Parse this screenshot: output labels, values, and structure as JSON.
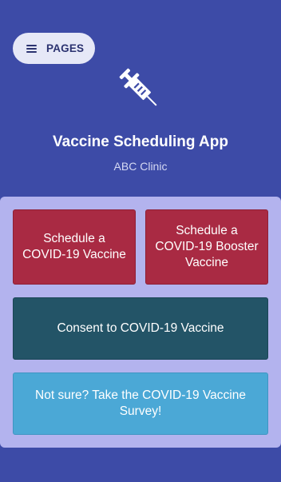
{
  "header": {
    "pages_label": "PAGES",
    "menu_icon": "hamburger-menu-icon",
    "app_icon": "syringe-icon",
    "title": "Vaccine Scheduling App",
    "subtitle": "ABC Clinic"
  },
  "tiles": [
    {
      "label": "Schedule a COVID-19 Vaccine",
      "color": "#a92a43"
    },
    {
      "label": "Schedule a COVID-19 Booster Vaccine",
      "color": "#a92a43"
    },
    {
      "label": "Consent to COVID-19 Vaccine",
      "color": "#235467"
    },
    {
      "label": "Not sure? Take the COVID-19 Vaccine Survey!",
      "color": "#4ba8d6"
    }
  ],
  "colors": {
    "background": "#3d4ba7",
    "panel": "#b3b3ee",
    "pages_button": "#e6e8f7"
  }
}
